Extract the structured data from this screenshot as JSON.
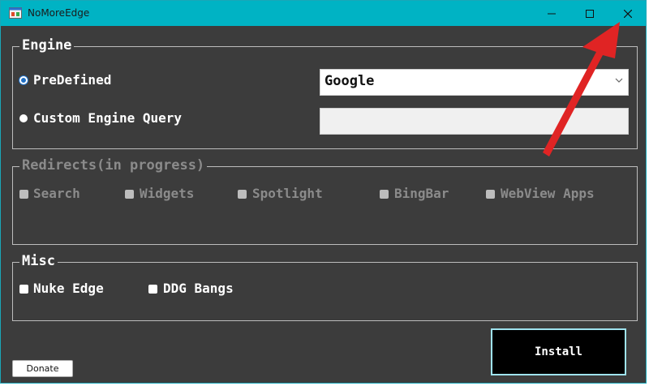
{
  "window": {
    "title": "NoMoreEdge"
  },
  "engine": {
    "legend": "Engine",
    "predefined_label": "PreDefined",
    "custom_label": "Custom Engine Query",
    "selected_engine": "Google",
    "custom_query_value": ""
  },
  "redirects": {
    "legend": "Redirects(in progress)",
    "items": [
      "Search",
      "Widgets",
      "Spotlight",
      "BingBar",
      "WebView Apps"
    ]
  },
  "misc": {
    "legend": "Misc",
    "items": [
      "Nuke Edge",
      "DDG Bangs"
    ]
  },
  "buttons": {
    "install": "Install",
    "donate": "Donate"
  },
  "colors": {
    "titlebar": "#00b3c4",
    "background": "#3c3c3c",
    "annotation_arrow": "#e02424"
  }
}
